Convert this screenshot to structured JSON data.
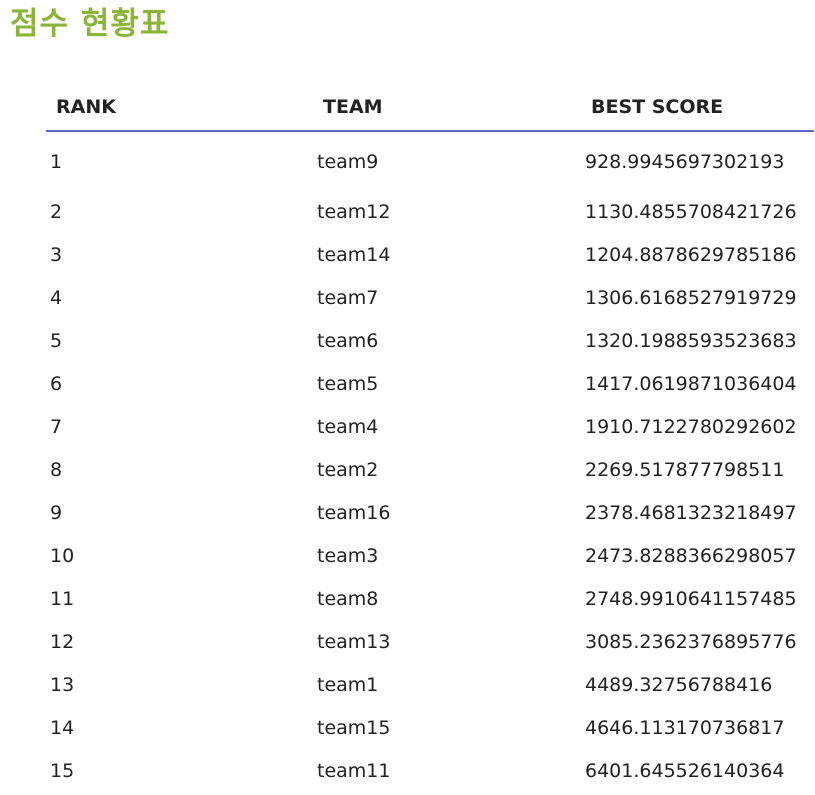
{
  "page": {
    "title": "점수 현황표"
  },
  "table": {
    "headers": {
      "rank": "RANK",
      "team": "TEAM",
      "best_score": "BEST SCORE"
    },
    "rows": [
      {
        "rank": "1",
        "team": "team9",
        "best_score": "928.9945697302193"
      },
      {
        "rank": "2",
        "team": "team12",
        "best_score": "1130.4855708421726"
      },
      {
        "rank": "3",
        "team": "team14",
        "best_score": "1204.8878629785186"
      },
      {
        "rank": "4",
        "team": "team7",
        "best_score": "1306.6168527919729"
      },
      {
        "rank": "5",
        "team": "team6",
        "best_score": "1320.1988593523683"
      },
      {
        "rank": "6",
        "team": "team5",
        "best_score": "1417.0619871036404"
      },
      {
        "rank": "7",
        "team": "team4",
        "best_score": "1910.7122780292602"
      },
      {
        "rank": "8",
        "team": "team2",
        "best_score": "2269.517877798511"
      },
      {
        "rank": "9",
        "team": "team16",
        "best_score": "2378.4681323218497"
      },
      {
        "rank": "10",
        "team": "team3",
        "best_score": "2473.8288366298057"
      },
      {
        "rank": "11",
        "team": "team8",
        "best_score": "2748.9910641157485"
      },
      {
        "rank": "12",
        "team": "team13",
        "best_score": "3085.2362376895776"
      },
      {
        "rank": "13",
        "team": "team1",
        "best_score": "4489.32756788416"
      },
      {
        "rank": "14",
        "team": "team15",
        "best_score": "4646.113170736817"
      },
      {
        "rank": "15",
        "team": "team11",
        "best_score": "6401.645526140364"
      }
    ]
  },
  "colors": {
    "title": "#8cb43a",
    "header_rule": "#5b6bc0",
    "text": "#222222"
  }
}
